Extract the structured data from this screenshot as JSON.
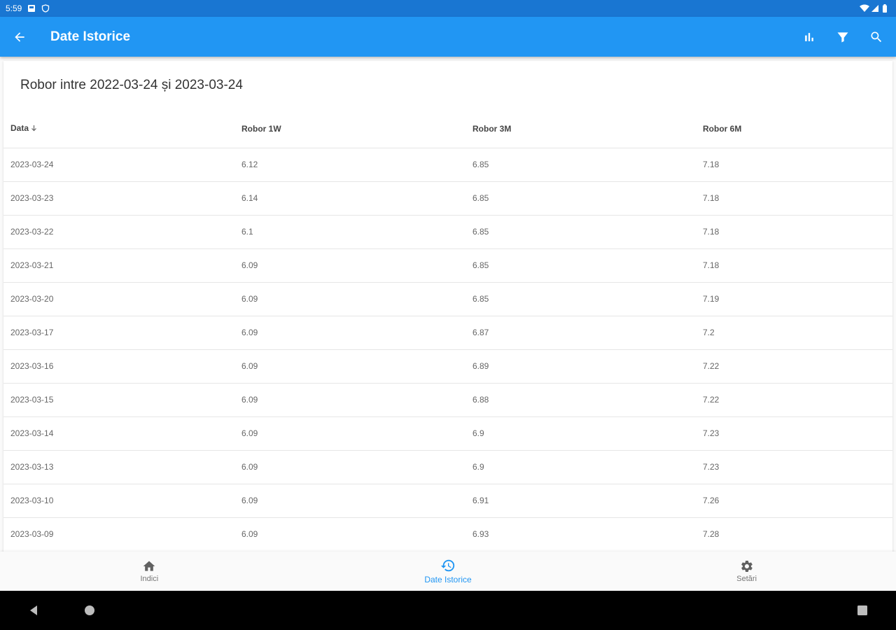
{
  "status_bar": {
    "time": "5:59"
  },
  "app_bar": {
    "title": "Date Istorice"
  },
  "card": {
    "title": "Robor intre 2022-03-24 și 2023-03-24"
  },
  "table": {
    "headers": [
      "Data",
      "Robor 1W",
      "Robor 3M",
      "Robor 6M"
    ],
    "rows": [
      [
        "2023-03-24",
        "6.12",
        "6.85",
        "7.18"
      ],
      [
        "2023-03-23",
        "6.14",
        "6.85",
        "7.18"
      ],
      [
        "2023-03-22",
        "6.1",
        "6.85",
        "7.18"
      ],
      [
        "2023-03-21",
        "6.09",
        "6.85",
        "7.18"
      ],
      [
        "2023-03-20",
        "6.09",
        "6.85",
        "7.19"
      ],
      [
        "2023-03-17",
        "6.09",
        "6.87",
        "7.2"
      ],
      [
        "2023-03-16",
        "6.09",
        "6.89",
        "7.22"
      ],
      [
        "2023-03-15",
        "6.09",
        "6.88",
        "7.22"
      ],
      [
        "2023-03-14",
        "6.09",
        "6.9",
        "7.23"
      ],
      [
        "2023-03-13",
        "6.09",
        "6.9",
        "7.23"
      ],
      [
        "2023-03-10",
        "6.09",
        "6.91",
        "7.26"
      ],
      [
        "2023-03-09",
        "6.09",
        "6.93",
        "7.28"
      ]
    ]
  },
  "bottom_nav": {
    "items": [
      {
        "label": "Indici",
        "icon": "home-icon"
      },
      {
        "label": "Date Istorice",
        "icon": "history-icon"
      },
      {
        "label": "Setări",
        "icon": "gear-icon"
      }
    ],
    "active_index": 1
  },
  "colors": {
    "primary": "#2196f3",
    "status_bar": "#1976d2",
    "system_nav": "#000000"
  }
}
